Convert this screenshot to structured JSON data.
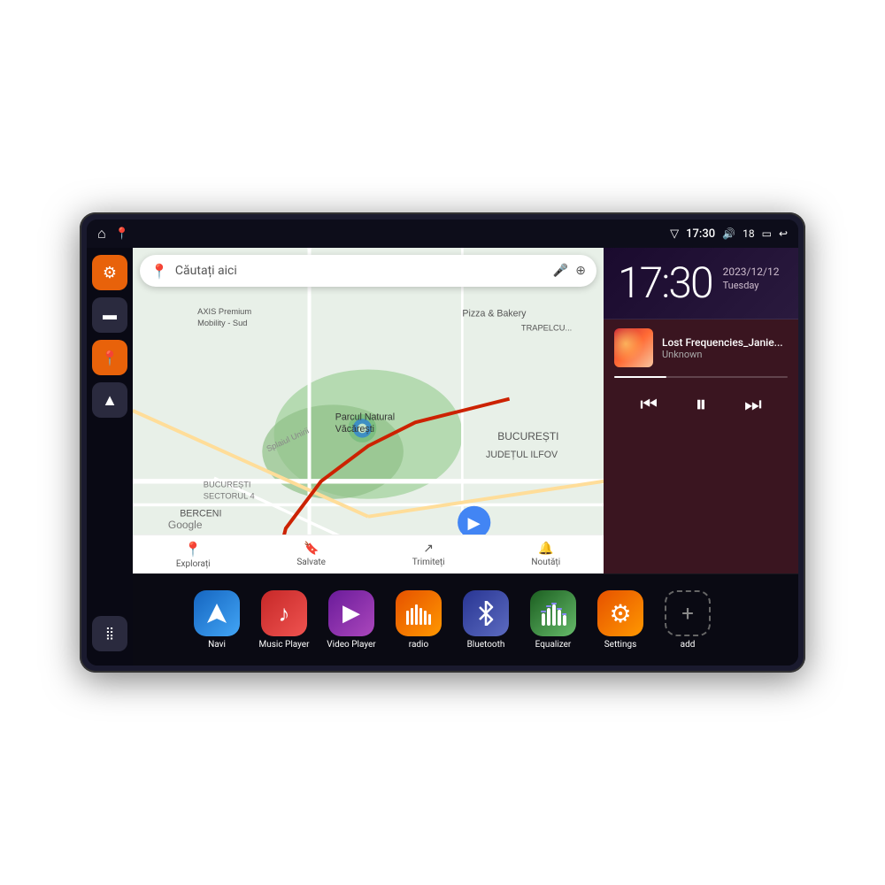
{
  "device": {
    "status_bar": {
      "home_icon": "⌂",
      "map_pin_icon": "📍",
      "wifi_icon": "▽",
      "time": "17:30",
      "volume_icon": "🔊",
      "battery_level": "18",
      "battery_icon": "▭",
      "back_icon": "↩"
    },
    "sidebar": {
      "items": [
        {
          "name": "settings-sidebar",
          "label": "Settings",
          "icon": "⚙",
          "color": "orange"
        },
        {
          "name": "folder-sidebar",
          "label": "Files",
          "icon": "▬",
          "color": "dark"
        },
        {
          "name": "map-sidebar",
          "label": "Map",
          "icon": "📍",
          "color": "orange"
        },
        {
          "name": "navigation-sidebar",
          "label": "Navigation",
          "icon": "▲",
          "color": "dark"
        },
        {
          "name": "apps-sidebar",
          "label": "Apps",
          "icon": "⋮⋮⋮",
          "color": "dark"
        }
      ]
    },
    "map": {
      "search_placeholder": "Căutați aici",
      "nav_items": [
        {
          "name": "explore",
          "icon": "📍",
          "label": "Explorați"
        },
        {
          "name": "saved",
          "icon": "🔖",
          "label": "Salvate"
        },
        {
          "name": "share",
          "icon": "↗",
          "label": "Trimiteți"
        },
        {
          "name": "updates",
          "icon": "🔔",
          "label": "Noutăți"
        }
      ],
      "locations": [
        "AXIS Premium Mobility - Sud",
        "Pizza & Bakery",
        "Parcul Natural Văcărești",
        "BUCUREȘTI",
        "JUDEȚUL ILFOV",
        "BUCUREȘTI SECTORUL 4",
        "BERCENI",
        "TRAPELCU..."
      ],
      "google_label": "Google"
    },
    "clock": {
      "time": "17:30",
      "date_line1": "2023/12/12",
      "date_line2": "Tuesday"
    },
    "music": {
      "title": "Lost Frequencies_Janie...",
      "artist": "Unknown",
      "prev_icon": "⏮",
      "pause_icon": "⏸",
      "next_icon": "⏭",
      "progress_percent": 30
    },
    "apps": [
      {
        "name": "navi",
        "label": "Navi",
        "icon": "▲",
        "color_class": "icon-navi"
      },
      {
        "name": "music-player",
        "label": "Music Player",
        "icon": "♪",
        "color_class": "icon-music"
      },
      {
        "name": "video-player",
        "label": "Video Player",
        "icon": "▶",
        "color_class": "icon-video"
      },
      {
        "name": "radio",
        "label": "radio",
        "icon": "📶",
        "color_class": "icon-radio"
      },
      {
        "name": "bluetooth",
        "label": "Bluetooth",
        "icon": "ʙ",
        "color_class": "icon-bluetooth"
      },
      {
        "name": "equalizer",
        "label": "Equalizer",
        "icon": "≡",
        "color_class": "icon-equalizer"
      },
      {
        "name": "settings",
        "label": "Settings",
        "icon": "⚙",
        "color_class": "icon-settings"
      },
      {
        "name": "add",
        "label": "add",
        "icon": "+",
        "color_class": "icon-add"
      }
    ]
  }
}
